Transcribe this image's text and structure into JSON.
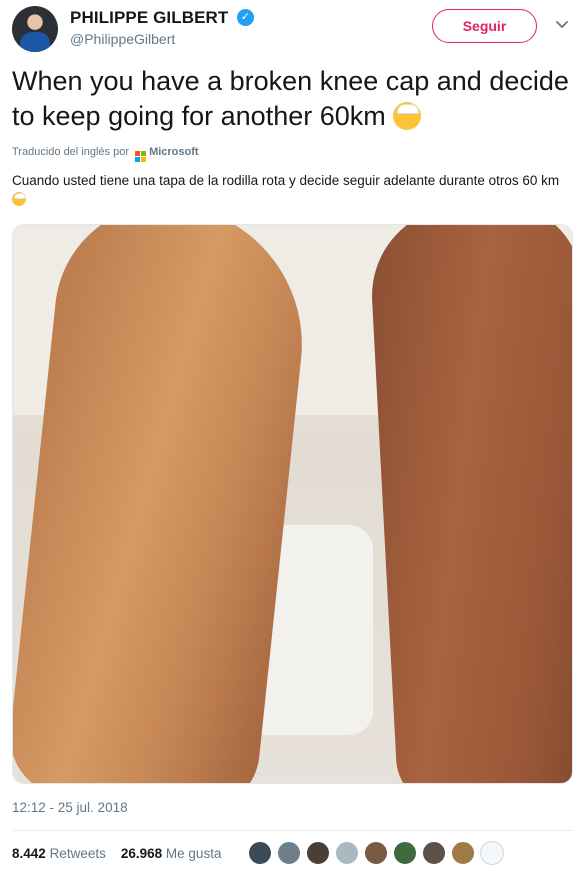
{
  "author": {
    "name": "PHILIPPE GILBERT",
    "handle": "@PhilippeGilbert",
    "verified_icon": "verified-badge-icon"
  },
  "follow_button": {
    "label": "Seguir"
  },
  "tweet": {
    "text": "When you have a broken knee cap and decide to keep going for another 60km",
    "translated_by": "Traducido del inglés por",
    "translator_name": "Microsoft",
    "translation": "Cuando usted tiene una tapa de la rodilla rota y decide seguir adelante durante otros 60 km",
    "emoji": "face-with-head-bandage"
  },
  "timestamp": "12:12 - 25 jul. 2018",
  "stats": {
    "retweets_count": "8.442",
    "retweets_label": "Retweets",
    "likes_count": "26.968",
    "likes_label": "Me gusta"
  },
  "colors": {
    "accent": "#e0245e",
    "verified": "#1da1f2",
    "meta_text": "#657786"
  }
}
